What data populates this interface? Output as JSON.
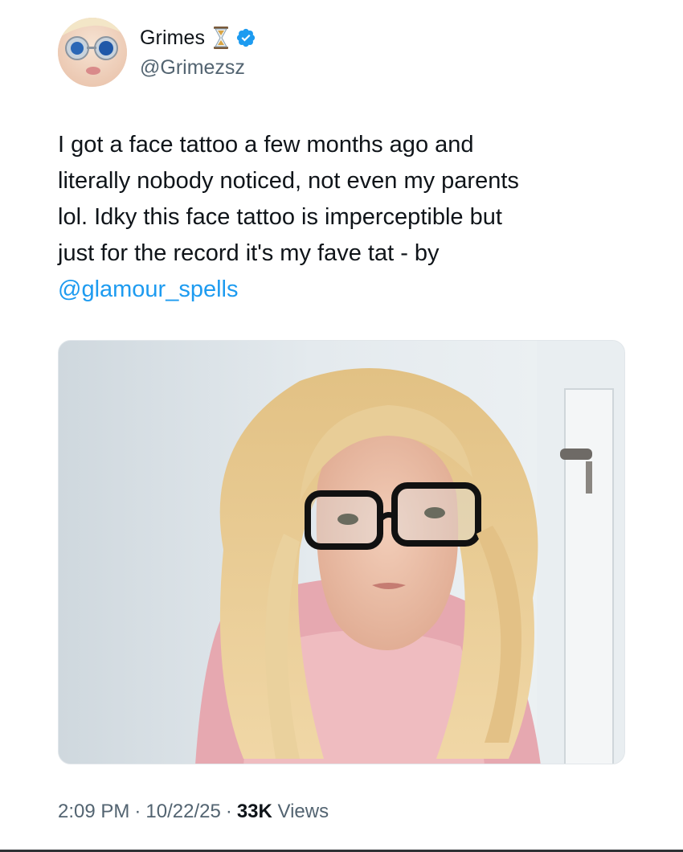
{
  "author": {
    "display_name": "Grimes",
    "handle": "@Grimezsz",
    "emoji_icon": "hourglass-icon",
    "verified_icon": "verified-badge-icon",
    "verified_color": "#1d9bf0"
  },
  "tweet": {
    "lines": [
      "I got a face tattoo a few months ago and",
      "literally nobody noticed, not even my parents",
      "lol.  Idky this face tattoo is imperceptible but",
      "just for the record it's my fave tat - by"
    ],
    "mention": "@glamour_spells",
    "mention_color": "#1d9bf0"
  },
  "media": {
    "kind": "photo",
    "description_icon": "selfie-photo"
  },
  "meta": {
    "time": "2:09 PM",
    "date": "10/22/25",
    "views_count": "33K",
    "views_label": "Views",
    "separator": "·"
  }
}
